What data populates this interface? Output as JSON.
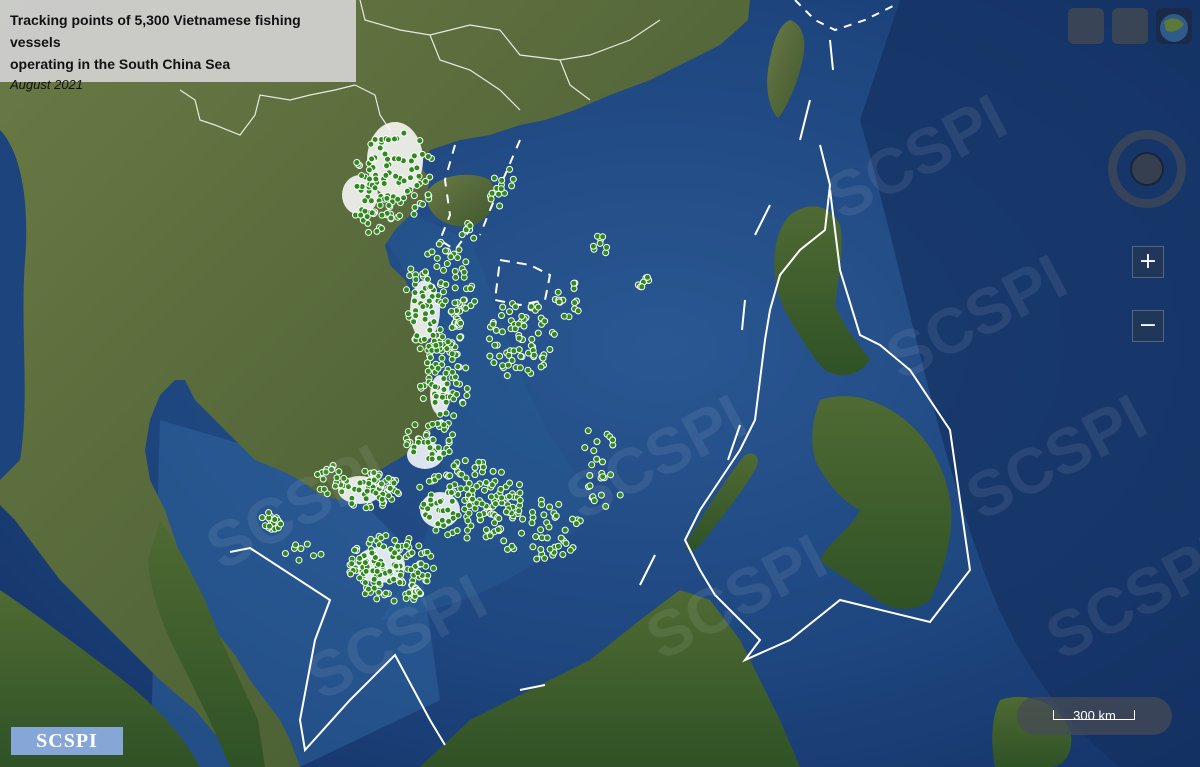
{
  "header": {
    "title_line1": "Tracking points of 5,300 Vietnamese fishing vessels",
    "title_line2": "operating in the South China Sea",
    "subtitle": "August 2021"
  },
  "controls": {
    "top_buttons": [
      "basemap-button",
      "layers-button",
      "satellite-thumbnail-button"
    ],
    "zoom_in": "+",
    "zoom_out": "−"
  },
  "scale": {
    "label": "300 km"
  },
  "logo": {
    "text": "SCSPI"
  },
  "watermark": {
    "text": "SCSPI"
  },
  "colors": {
    "sea": "#1c3f75",
    "land": "#5a6d38",
    "vessel_fill": "#2e8a1c",
    "vessel_outline": "#ffffff",
    "boundary": "#ffffff",
    "title_panel": "#d2d2d2",
    "logo_bg": "#87a6d8"
  },
  "icons": {
    "compass": "compass-icon",
    "zoom_in": "plus-icon",
    "zoom_out": "minus-icon"
  }
}
